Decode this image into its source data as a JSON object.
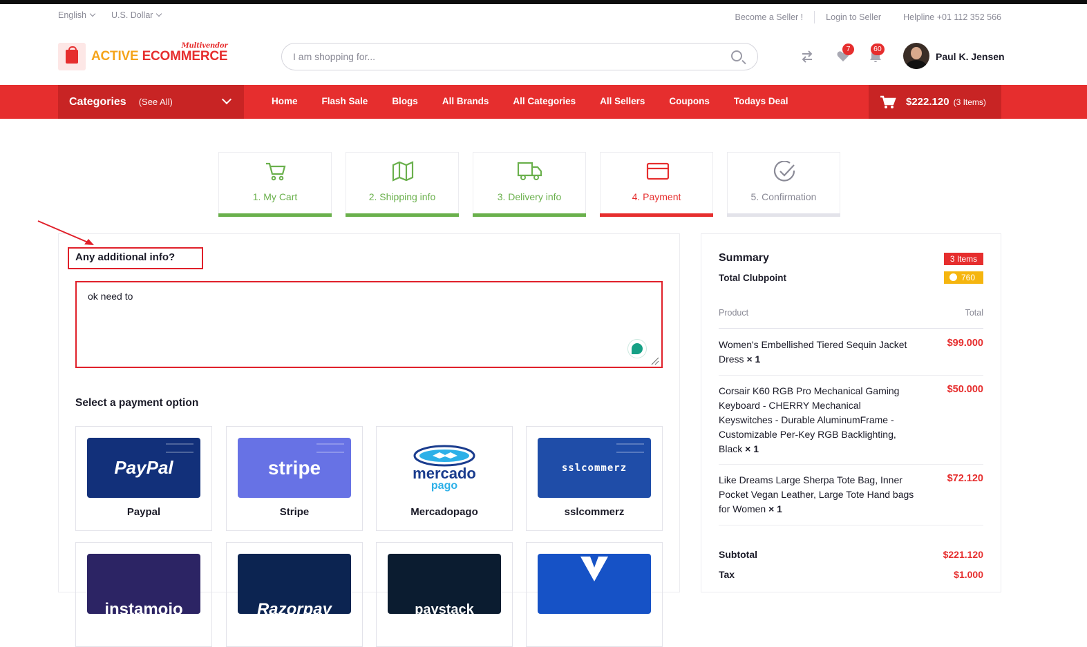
{
  "topbar": {
    "language": "English",
    "currency": "U.S. Dollar",
    "become_seller": "Become a Seller !",
    "login_seller": "Login to Seller",
    "helpline": "Helpline +01 112 352 566"
  },
  "header": {
    "logo_part1": "ACTIVE ",
    "logo_part2": "ECOMMERCE",
    "logo_sub": "Multivendor",
    "search_placeholder": "I am shopping for...",
    "wishlist_count": "7",
    "notification_count": "60",
    "user_name": "Paul K. Jensen"
  },
  "nav": {
    "categories_label": "Categories",
    "see_all": "(See All)",
    "links": [
      "Home",
      "Flash Sale",
      "Blogs",
      "All Brands",
      "All Categories",
      "All Sellers",
      "Coupons",
      "Todays Deal"
    ],
    "cart_amount": "$222.120",
    "cart_items": "(3 Items)"
  },
  "steps": [
    {
      "label": "1. My Cart",
      "state": "done"
    },
    {
      "label": "2. Shipping info",
      "state": "done"
    },
    {
      "label": "3. Delivery info",
      "state": "done"
    },
    {
      "label": "4. Payment",
      "state": "active"
    },
    {
      "label": "5. Confirmation",
      "state": "pending"
    }
  ],
  "colors": {
    "done": "#6ab04c",
    "active": "#e62e2e",
    "pending": "#8a8a96",
    "pending_bar": "#e3e3ea"
  },
  "additional_info": {
    "heading": "Any additional info?",
    "value": "ok need to"
  },
  "payment": {
    "heading": "Select a payment option",
    "options": [
      {
        "name": "Paypal",
        "logo_text": "PayPal"
      },
      {
        "name": "Stripe",
        "logo_text": "stripe"
      },
      {
        "name": "Mercadopago",
        "logo_text": "mercado"
      },
      {
        "name": "sslcommerz",
        "logo_text": "sslcommerz"
      },
      {
        "logo_text": "instamojo"
      },
      {
        "logo_text": "Razorpay"
      },
      {
        "logo_text": "paystack"
      },
      {
        "logo_text": ""
      }
    ],
    "mercado_sub": "pago"
  },
  "summary": {
    "title": "Summary",
    "items_badge": "3 Items",
    "clubpoint_label": "Total Clubpoint",
    "clubpoint_value": "760",
    "col_product": "Product",
    "col_total": "Total",
    "products": [
      {
        "name": "Women's Embellished Tiered Sequin Jacket Dress",
        "qty": "× 1",
        "total": "$99.000"
      },
      {
        "name": "Corsair K60 RGB Pro Mechanical Gaming Keyboard - CHERRY Mechanical Keyswitches - Durable AluminumFrame - Customizable Per-Key RGB Backlighting, Black",
        "qty": "× 1",
        "total": "$50.000"
      },
      {
        "name": "Like Dreams Large Sherpa Tote Bag, Inner Pocket Vegan Leather, Large Tote Hand bags for Women",
        "qty": "× 1",
        "total": "$72.120"
      }
    ],
    "subtotal_label": "Subtotal",
    "subtotal_value": "$221.120",
    "tax_label": "Tax",
    "tax_value": "$1.000"
  }
}
